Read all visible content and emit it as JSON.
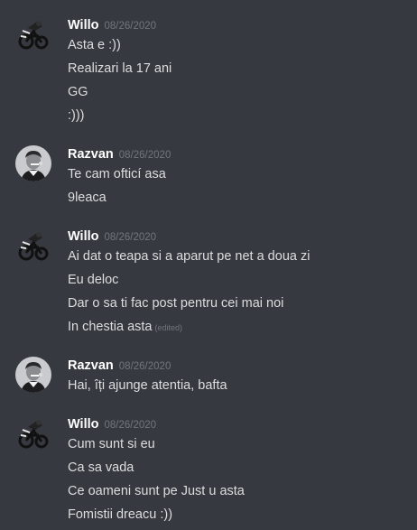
{
  "messages": [
    {
      "author": "Willo",
      "timestamp": "08/26/2020",
      "lines": [
        {
          "text": "Asta e :))"
        },
        {
          "text": "Realizari la 17 ani"
        },
        {
          "text": "GG"
        },
        {
          "text": ":)))"
        }
      ]
    },
    {
      "author": "Razvan",
      "timestamp": "08/26/2020",
      "lines": [
        {
          "text": "Te cam ofticí asa"
        },
        {
          "text": "9leaca"
        }
      ]
    },
    {
      "author": "Willo",
      "timestamp": "08/26/2020",
      "lines": [
        {
          "text": "Ai dat o teapa si a aparut pe net a doua zi"
        },
        {
          "text": "Eu deloc"
        },
        {
          "text": "Dar o sa ti fac post pentru cei mai noi"
        },
        {
          "text": "In chestia asta",
          "edited": "(edited)"
        }
      ]
    },
    {
      "author": "Razvan",
      "timestamp": "08/26/2020",
      "lines": [
        {
          "text": "Hai, îți ajunge atentia, bafta"
        }
      ]
    },
    {
      "author": "Willo",
      "timestamp": "08/26/2020",
      "lines": [
        {
          "text": "Cum sunt si eu"
        },
        {
          "text": "Ca sa vada"
        },
        {
          "text": "Ce oameni sunt pe Just u asta"
        },
        {
          "text": "Fomistii dreacu :))"
        }
      ]
    }
  ],
  "colors": {
    "background": "#36393f",
    "username": "#ffffff",
    "timestamp": "#72767d",
    "message_text": "#dcddde"
  },
  "icons": {
    "willo_avatar": "bike-rider-avatar-icon",
    "razvan_avatar": "person-portrait-avatar-icon"
  }
}
